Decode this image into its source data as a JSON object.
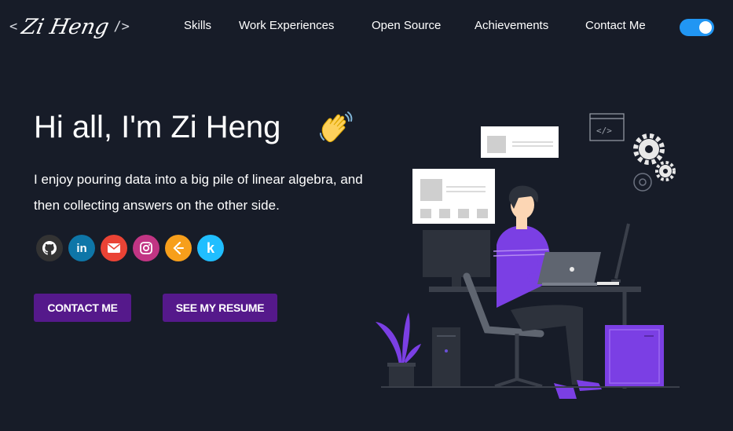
{
  "logo": {
    "open": "<",
    "name": "Zi Heng",
    "close": "/>"
  },
  "nav": {
    "links": [
      "Skills",
      "Work Experiences",
      "Open Source",
      "Achievements",
      "Contact Me"
    ]
  },
  "theme_toggle": {
    "on": true,
    "color": "#2196f3"
  },
  "hero": {
    "greeting": "Hi all, I'm Zi Heng",
    "subtitle": "I enjoy pouring data into a big pile of linear algebra, and then collecting answers on the other side.",
    "socials": [
      {
        "icon": "github-icon",
        "glyph": "",
        "color": "#333333"
      },
      {
        "icon": "linkedin-icon",
        "glyph": "in",
        "color": "#0e76a8"
      },
      {
        "icon": "email-icon",
        "glyph": "",
        "color": "#ea4335"
      },
      {
        "icon": "instagram-icon",
        "glyph": "",
        "color": "#c13584"
      },
      {
        "icon": "leetcode-icon",
        "glyph": "",
        "color": "#f79f1b"
      },
      {
        "icon": "kaggle-icon",
        "glyph": "k",
        "color": "#20beff"
      }
    ],
    "buttons": {
      "contact": "CONTACT ME",
      "resume": "SEE MY RESUME"
    }
  },
  "colors": {
    "background": "#171c28",
    "accent": "#55198b"
  }
}
